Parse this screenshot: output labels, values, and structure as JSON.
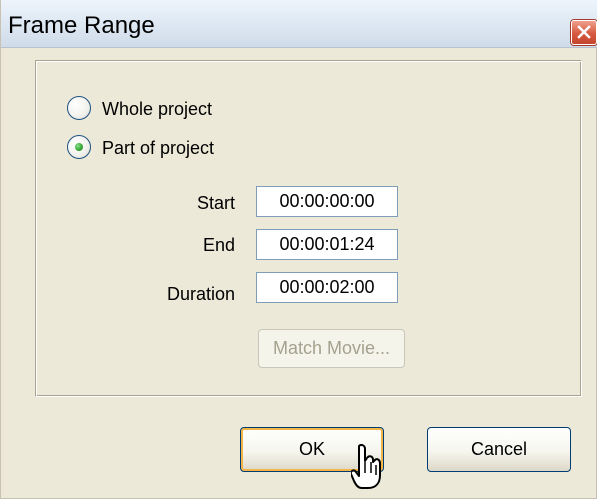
{
  "window": {
    "title": "Frame Range"
  },
  "options": {
    "whole_project": {
      "label": "Whole project",
      "selected": false
    },
    "part_of_project": {
      "label": "Part of project",
      "selected": true
    }
  },
  "fields": {
    "start": {
      "label": "Start",
      "value": "00:00:00:00"
    },
    "end": {
      "label": "End",
      "value": "00:00:01:24"
    },
    "duration": {
      "label": "Duration",
      "value": "00:00:02:00"
    }
  },
  "buttons": {
    "match_movie": "Match Movie...",
    "ok": "OK",
    "cancel": "Cancel"
  },
  "icons": {
    "close": "close-icon",
    "cursor": "mouse-cursor-icon"
  },
  "colors": {
    "titlebar": "#dce7f2",
    "dialog_background": "#ece9d8",
    "close_button": "#d65a3f",
    "radio_selected": "#35a935",
    "focus_ring": "#f3b646",
    "disabled_text": "#a5a18f"
  }
}
